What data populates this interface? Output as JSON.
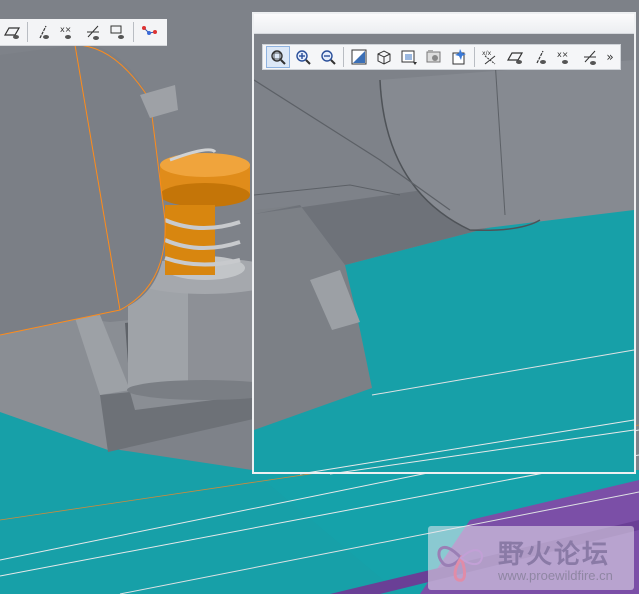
{
  "scene": {
    "description_colors": {
      "part_gray": "#7e8289",
      "part_gray_dark": "#62666c",
      "part_gray_light": "#a6a9ae",
      "floor_teal": "#17a0a8",
      "floor_teal_dark": "#0e8a92",
      "purple": "#7b4fa7",
      "spring_orange": "#e08c1a",
      "highlight_orange": "#ff8c1a"
    }
  },
  "main_toolbar": {
    "icons": [
      "datum-plane-display-icon",
      "datum-axis-display-icon",
      "point-display-icon",
      "csys-display-icon",
      "annotation-display-icon",
      "spin-center-icon"
    ]
  },
  "zoom_window": {
    "toolbar_icons": [
      "zoom-to-fit-icon",
      "zoom-in-icon",
      "zoom-out-icon",
      "repaint-icon",
      "display-style-icon",
      "saved-views-icon",
      "view-manager-icon",
      "appearance-icon",
      "datum-display-filter-icon",
      "datum-plane-display-icon",
      "datum-axis-display-icon",
      "point-display-icon",
      "csys-display-icon"
    ],
    "more_label": "»"
  },
  "watermark": {
    "chinese_text": "野火论坛",
    "url": "www.proewildfire.cn"
  }
}
